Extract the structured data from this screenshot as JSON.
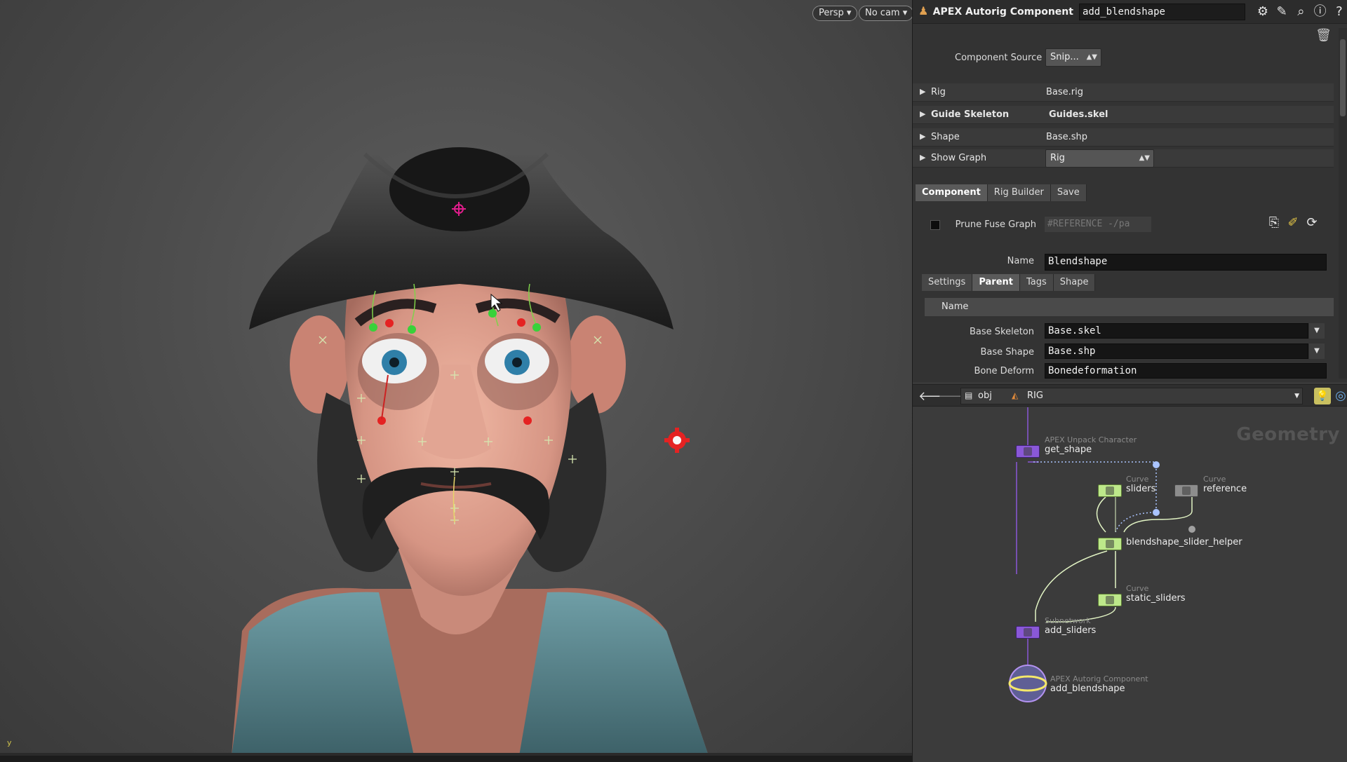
{
  "viewport": {
    "persp_label": "Persp",
    "cam_label": "No cam",
    "axis_label": "y"
  },
  "params": {
    "node_type": "APEX Autorig Component",
    "node_name": "add_blendshape",
    "component_source_label": "Component Source",
    "component_source_value": "Snip...",
    "folders": [
      {
        "label": "Rig",
        "value": "Base.rig"
      },
      {
        "label": "Guide Skeleton",
        "value": "Guides.skel"
      },
      {
        "label": "Shape",
        "value": "Base.shp"
      },
      {
        "label": "Show Graph",
        "value": "Rig"
      }
    ],
    "main_tabs": [
      "Component",
      "Rig Builder",
      "Save"
    ],
    "prune_label": "Prune Fuse Graph",
    "prune_ref": "#REFERENCE -/pa",
    "name_label": "Name",
    "name_value": "Blendshape",
    "sub_tabs": [
      "Settings",
      "Parent",
      "Tags",
      "Shape"
    ],
    "list_header": "Name",
    "base_skeleton_label": "Base Skeleton",
    "base_skeleton_value": "Base.skel",
    "base_shape_label": "Base Shape",
    "base_shape_value": "Base.shp",
    "bone_deform_label": "Bone Deform",
    "bone_deform_value": "Bonedeformation"
  },
  "network": {
    "path": [
      "obj",
      "RIG"
    ],
    "title": "Geometry",
    "nodes": [
      {
        "type": "APEX Unpack Character",
        "name": "get_shape"
      },
      {
        "type": "Curve",
        "name": "sliders"
      },
      {
        "type": "Curve",
        "name": "reference"
      },
      {
        "type": "",
        "name": "blendshape_slider_helper"
      },
      {
        "type": "Curve",
        "name": "static_sliders"
      },
      {
        "type": "Subnetwork",
        "name": "add_sliders"
      },
      {
        "type": "APEX Autorig Component",
        "name": "add_blendshape"
      }
    ]
  },
  "colors": {
    "purple_node": "#8a58d8",
    "green_node": "#bde88a",
    "gray_node": "#8d8d8d",
    "selected_outline": "#f4e86a"
  }
}
